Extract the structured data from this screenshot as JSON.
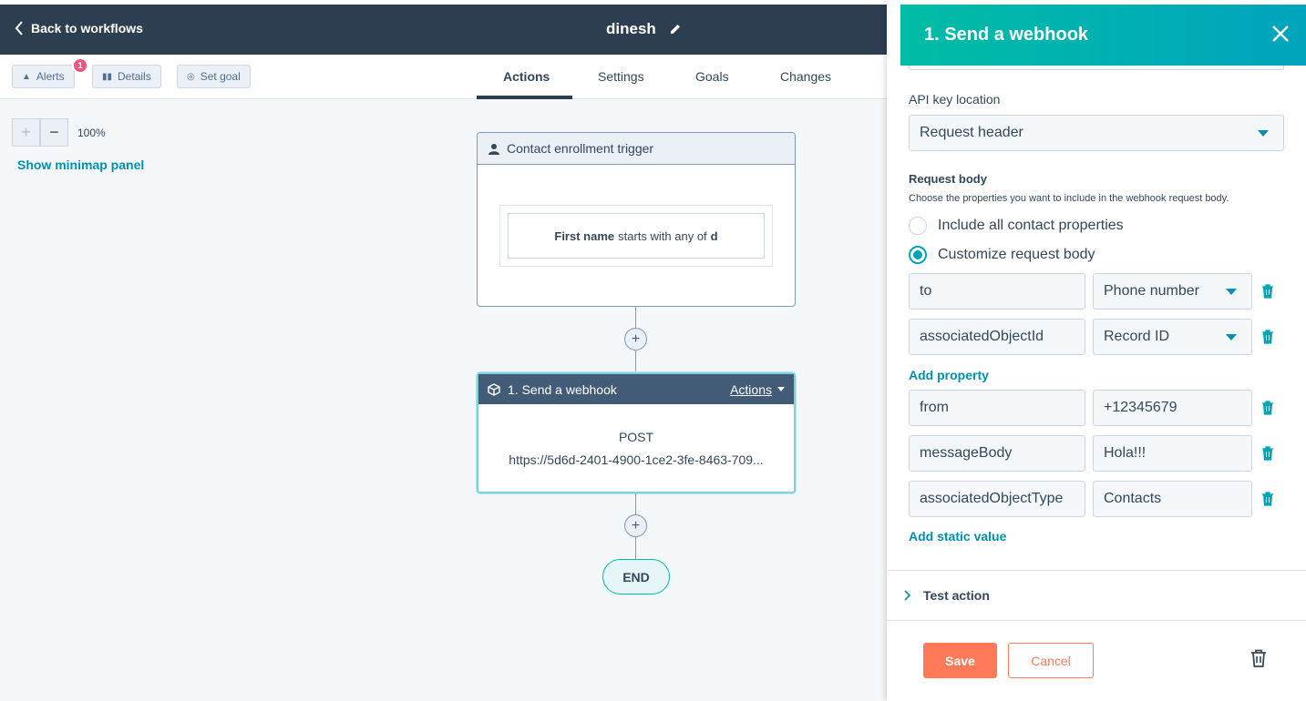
{
  "colors": {
    "accent": "#00a4bd",
    "header": "#2d3e50",
    "save": "#ff7a59",
    "badge": "#f2547d"
  },
  "topbar": {
    "back_label": "Back to workflows",
    "workflow_name": "dinesh"
  },
  "toolbar": {
    "alerts_label": "Alerts",
    "alerts_count": "1",
    "details_label": "Details",
    "setgoal_label": "Set goal"
  },
  "tabs": [
    {
      "label": "Actions",
      "active": true
    },
    {
      "label": "Settings"
    },
    {
      "label": "Goals"
    },
    {
      "label": "Changes"
    }
  ],
  "zoom": {
    "plus": "+",
    "minus": "−",
    "level": "100%",
    "minimap_label": "Show minimap panel"
  },
  "trigger": {
    "title": "Contact enrollment trigger",
    "filter_prop": "First name",
    "filter_op": "starts with any of",
    "filter_value": "d"
  },
  "webhook_card": {
    "title": "1. Send a webhook",
    "actions_label": "Actions",
    "method": "POST",
    "url": "https://5d6d-2401-4900-1ce2-3fe-8463-709..."
  },
  "flow": {
    "plus": "+",
    "end_label": "END"
  },
  "panel": {
    "title": "1. Send a webhook",
    "api_key_location_label": "API key location",
    "api_key_location_value": "Request header",
    "request_body_label": "Request body",
    "request_body_help": "Choose the properties you want to include in the webhook request body.",
    "radio_all": "Include all contact properties",
    "radio_custom": "Customize request body",
    "property_rows": [
      {
        "key": "to",
        "value": "Phone number"
      },
      {
        "key": "associatedObjectId",
        "value": "Record ID"
      }
    ],
    "add_property_label": "Add property",
    "static_rows": [
      {
        "key": "from",
        "value": "+12345679"
      },
      {
        "key": "messageBody",
        "value": "Hola!!!"
      },
      {
        "key": "associatedObjectType",
        "value": "Contacts"
      }
    ],
    "add_static_label": "Add static value",
    "test_action_label": "Test action",
    "save_label": "Save",
    "cancel_label": "Cancel"
  }
}
